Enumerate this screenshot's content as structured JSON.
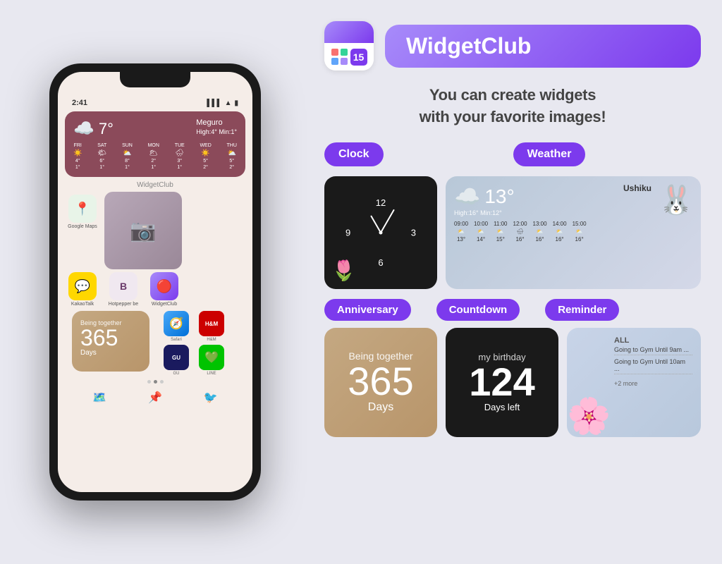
{
  "background_color": "#e8e8f0",
  "left_panel": {
    "phone": {
      "status_time": "2:41",
      "weather_widget": {
        "temperature": "7°",
        "location": "Meguro",
        "high_low": "High:4° Min:1°",
        "forecast": [
          {
            "day": "FRI",
            "icon": "☀️",
            "temp": "4°\n1°"
          },
          {
            "day": "SAT",
            "icon": "🌤",
            "temp": "6°\n1°"
          },
          {
            "day": "SUN",
            "icon": "⛅",
            "temp": "8°\n1°"
          },
          {
            "day": "MON",
            "icon": "🌥",
            "temp": "2°\n1°"
          },
          {
            "day": "TUE",
            "icon": "🌧",
            "temp": "3°\n1°"
          },
          {
            "day": "WED",
            "icon": "☀️",
            "temp": "5°\n2°"
          },
          {
            "day": "THU",
            "icon": "⛅",
            "temp": "5°\n2°"
          }
        ]
      },
      "widgetclub_label": "WidgetClub",
      "apps": [
        {
          "label": "Google Maps",
          "icon": "📍",
          "bg": "#e8f4e8"
        },
        {
          "label": "KakaoTalk",
          "icon": "💬",
          "bg": "#ffd700"
        },
        {
          "label": "Hotpepper be",
          "icon": "B",
          "bg": "#f5f0f5"
        },
        {
          "label": "WidgetClub",
          "icon": "🔴",
          "bg": "#ff4444"
        }
      ],
      "anniversary": {
        "label": "Being together",
        "number": "365",
        "unit": "Days"
      },
      "bottom_apps": [
        {
          "label": "WidgetClub",
          "icon": "🔴"
        },
        {
          "label": "GU",
          "icon": "GU"
        },
        {
          "label": "LINE",
          "icon": "💚"
        },
        {
          "label": "H&M",
          "icon": "H&M"
        },
        {
          "label": "Safari",
          "icon": "🧭"
        }
      ],
      "page_dots": 3,
      "active_dot": 1
    }
  },
  "right_panel": {
    "app_icon": {
      "alt": "WidgetClub App Icon"
    },
    "brand_name": "WidgetClub",
    "tagline_line1": "You can create widgets",
    "tagline_line2": "with your favorite images!",
    "categories": [
      {
        "label": "Clock",
        "widget": {
          "type": "clock",
          "numbers": [
            "12",
            "3",
            "6",
            "9"
          ]
        }
      },
      {
        "label": "Weather",
        "widget": {
          "type": "weather",
          "location": "Ushiku",
          "temperature": "13°",
          "high_low": "High:16° Min:12°",
          "forecast": [
            {
              "time": "09:00",
              "icon": "⛅",
              "temp": "13°"
            },
            {
              "time": "10:00",
              "icon": "⛅",
              "temp": "14°"
            },
            {
              "time": "11:00",
              "icon": "⛅",
              "temp": "15°"
            },
            {
              "time": "12:00",
              "icon": "🌧",
              "temp": "16°"
            },
            {
              "time": "13:00",
              "icon": "⛅",
              "temp": "16°"
            },
            {
              "time": "14:00",
              "icon": "⛅",
              "temp": "16°"
            },
            {
              "time": "15:00",
              "icon": "⛅",
              "temp": "16°"
            }
          ]
        }
      },
      {
        "label": "Anniversary",
        "widget": {
          "type": "anniversary",
          "label": "Being together",
          "number": "365",
          "unit": "Days"
        }
      },
      {
        "label": "Countdown",
        "widget": {
          "type": "countdown",
          "label": "my birthday",
          "number": "124",
          "unit": "Days left"
        }
      },
      {
        "label": "Reminder",
        "widget": {
          "type": "reminder",
          "header": "ALL",
          "items": [
            "Going to Gym Until 9am ...",
            "Going to Gym Until 10am ...",
            ""
          ],
          "more": "+2 more"
        }
      }
    ]
  }
}
